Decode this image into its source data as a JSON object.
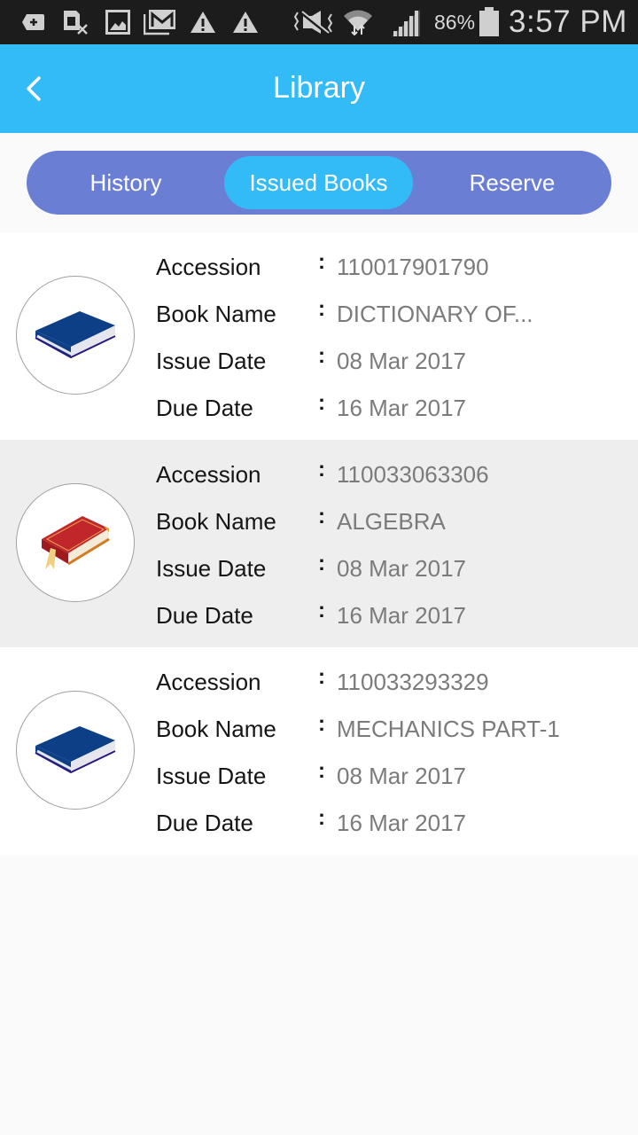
{
  "status_bar": {
    "icons": [
      "add-notification-icon",
      "sim-missing-icon",
      "gallery-icon",
      "gmail-icon",
      "warning-icon",
      "warning-icon",
      "vibrate-mute-icon",
      "wifi-icon",
      "signal-icon",
      "battery-icon"
    ],
    "battery_percent": "86%",
    "time": "3:57 PM"
  },
  "app_bar": {
    "title": "Library",
    "back_icon": "chevron-left-icon"
  },
  "tabs": [
    {
      "label": "History",
      "selected": false
    },
    {
      "label": "Issued Books",
      "selected": true
    },
    {
      "label": "Reserve",
      "selected": false
    }
  ],
  "fields": {
    "accession": "Accession",
    "book_name": "Book Name",
    "issue_date": "Issue Date",
    "due_date": "Due Date",
    "separator": ":"
  },
  "books": [
    {
      "icon": "blue-book-icon",
      "accession": "110017901790",
      "book_name": "DICTIONARY OF...",
      "issue_date": "08 Mar 2017",
      "due_date": "16 Mar 2017"
    },
    {
      "icon": "red-book-icon",
      "accession": "110033063306",
      "book_name": "ALGEBRA",
      "issue_date": "08 Mar 2017",
      "due_date": "16 Mar 2017"
    },
    {
      "icon": "blue-book-icon",
      "accession": "110033293329",
      "book_name": "MECHANICS PART-1",
      "issue_date": "08 Mar 2017",
      "due_date": "16 Mar 2017"
    }
  ],
  "colors": {
    "app_bar": "#33bbf8",
    "tab_track": "#6a7fd4",
    "tab_selected": "#33bbf8",
    "label_text": "#151515",
    "value_text": "#7b7b7b",
    "alt_row": "#eeeeee"
  }
}
